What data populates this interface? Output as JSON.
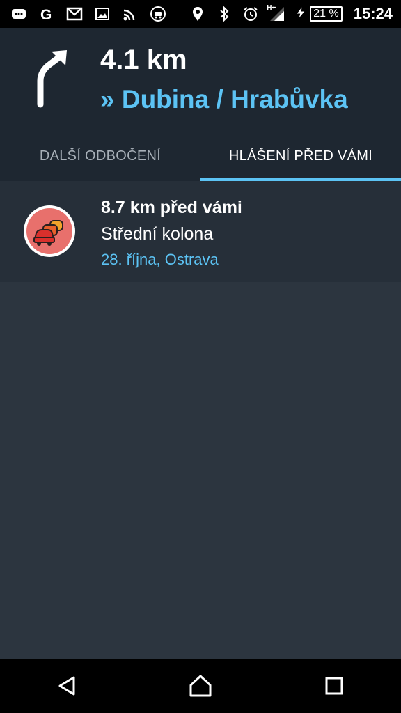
{
  "status_bar": {
    "icons_left": [
      "chat-icon",
      "google-icon",
      "gmail-icon",
      "image-icon",
      "cast-icon",
      "notification-app-icon"
    ],
    "icons_right": [
      "location-icon",
      "bluetooth-icon",
      "alarm-icon",
      "signal-icon",
      "charging-icon"
    ],
    "network": "H+",
    "battery": "21 %",
    "time": "15:24"
  },
  "navigation": {
    "distance": "4.1 km",
    "street": "» Dubina / Hrabůvka",
    "turn_icon": "turn-right-arrow-icon"
  },
  "tabs": [
    {
      "label": "DALŠÍ ODBOČENÍ",
      "active": false
    },
    {
      "label": "HLÁŠENÍ PŘED VÁMI",
      "active": true
    }
  ],
  "alerts": [
    {
      "distance": "8.7 km před vámi",
      "type": "Střední kolona",
      "location": "28. října, Ostrava",
      "icon": "traffic-jam-icon"
    }
  ],
  "nav_bar": {
    "back": "back-icon",
    "home": "home-icon",
    "recents": "recents-icon"
  },
  "colors": {
    "accent": "#5cc3f4",
    "header_bg": "#1e2731",
    "body_bg": "#2c353f",
    "alert_icon_bg": "#e8706c"
  }
}
